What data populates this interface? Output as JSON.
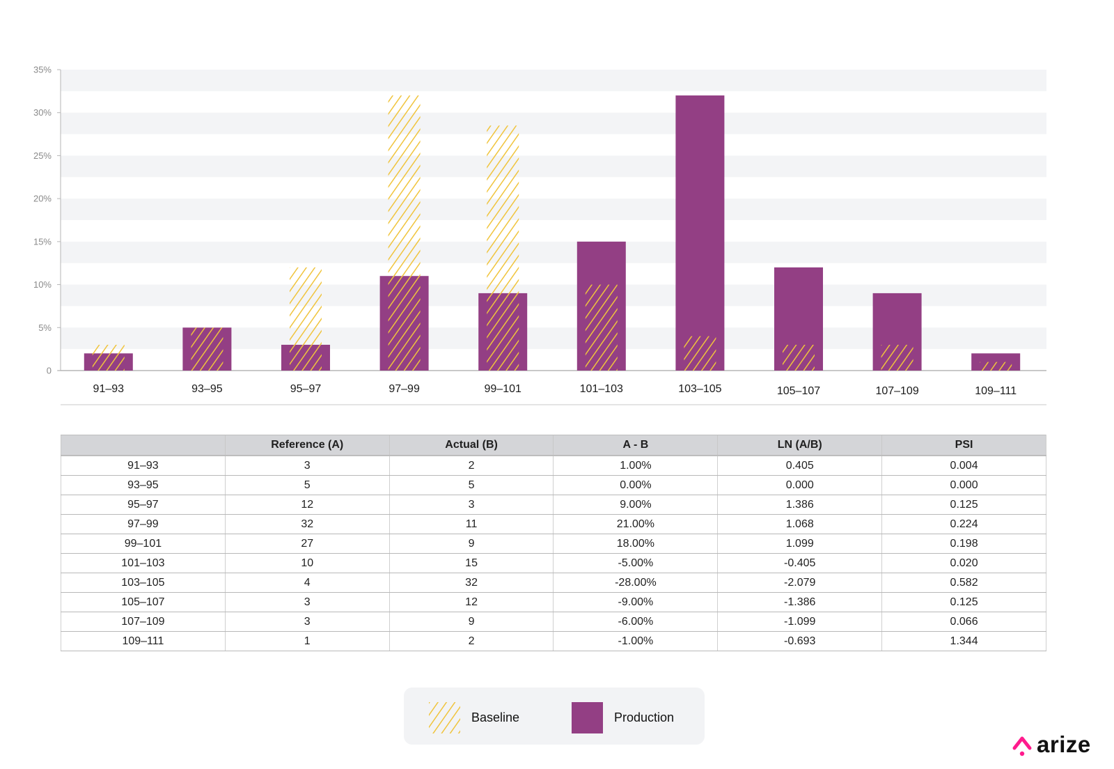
{
  "chart_data": {
    "type": "bar",
    "title": "",
    "xlabel": "",
    "ylabel": "",
    "ylim": [
      0,
      35
    ],
    "y_ticks": [
      "0",
      "5%",
      "10%",
      "15%",
      "20%",
      "25%",
      "30%",
      "35%"
    ],
    "y_tick_values": [
      0,
      5,
      10,
      15,
      20,
      25,
      30,
      35
    ],
    "grid": "alternating horizontal bands",
    "categories": [
      "91–93",
      "93–95",
      "95–97",
      "97–99",
      "99–101",
      "101–103",
      "103–105",
      "105–107",
      "107–109",
      "109–111"
    ],
    "series": [
      {
        "name": "Baseline",
        "style": "hatched",
        "color": "#f0c43c",
        "values": [
          3,
          5,
          12,
          32,
          28.5,
          10,
          4,
          3,
          3,
          1
        ]
      },
      {
        "name": "Production",
        "style": "solid",
        "color": "#933f84",
        "values": [
          2,
          5,
          3,
          11,
          9,
          15,
          32,
          12,
          9,
          2
        ]
      }
    ],
    "legend_position": "bottom-center"
  },
  "table": {
    "headers": [
      "",
      "Reference (A)",
      "Actual (B)",
      "A - B",
      "LN (A/B)",
      "PSI"
    ],
    "rows": [
      [
        "91–93",
        "3",
        "2",
        "1.00%",
        "0.405",
        "0.004"
      ],
      [
        "93–95",
        "5",
        "5",
        "0.00%",
        "0.000",
        "0.000"
      ],
      [
        "95–97",
        "12",
        "3",
        "9.00%",
        "1.386",
        "0.125"
      ],
      [
        "97–99",
        "32",
        "11",
        "21.00%",
        "1.068",
        "0.224"
      ],
      [
        "99–101",
        "27",
        "9",
        "18.00%",
        "1.099",
        "0.198"
      ],
      [
        "101–103",
        "10",
        "15",
        "-5.00%",
        "-0.405",
        "0.020"
      ],
      [
        "103–105",
        "4",
        "32",
        "-28.00%",
        "-2.079",
        "0.582"
      ],
      [
        "105–107",
        "3",
        "12",
        "-9.00%",
        "-1.386",
        "0.125"
      ],
      [
        "107–109",
        "3",
        "9",
        "-6.00%",
        "-1.099",
        "0.066"
      ],
      [
        "109–111",
        "1",
        "2",
        "-1.00%",
        "-0.693",
        "1.344"
      ]
    ]
  },
  "legend": {
    "baseline_label": "Baseline",
    "production_label": "Production"
  },
  "brand": {
    "name": "arize",
    "logo_icon": "arize-caret-icon",
    "accent_color": "#ff1b8d"
  }
}
